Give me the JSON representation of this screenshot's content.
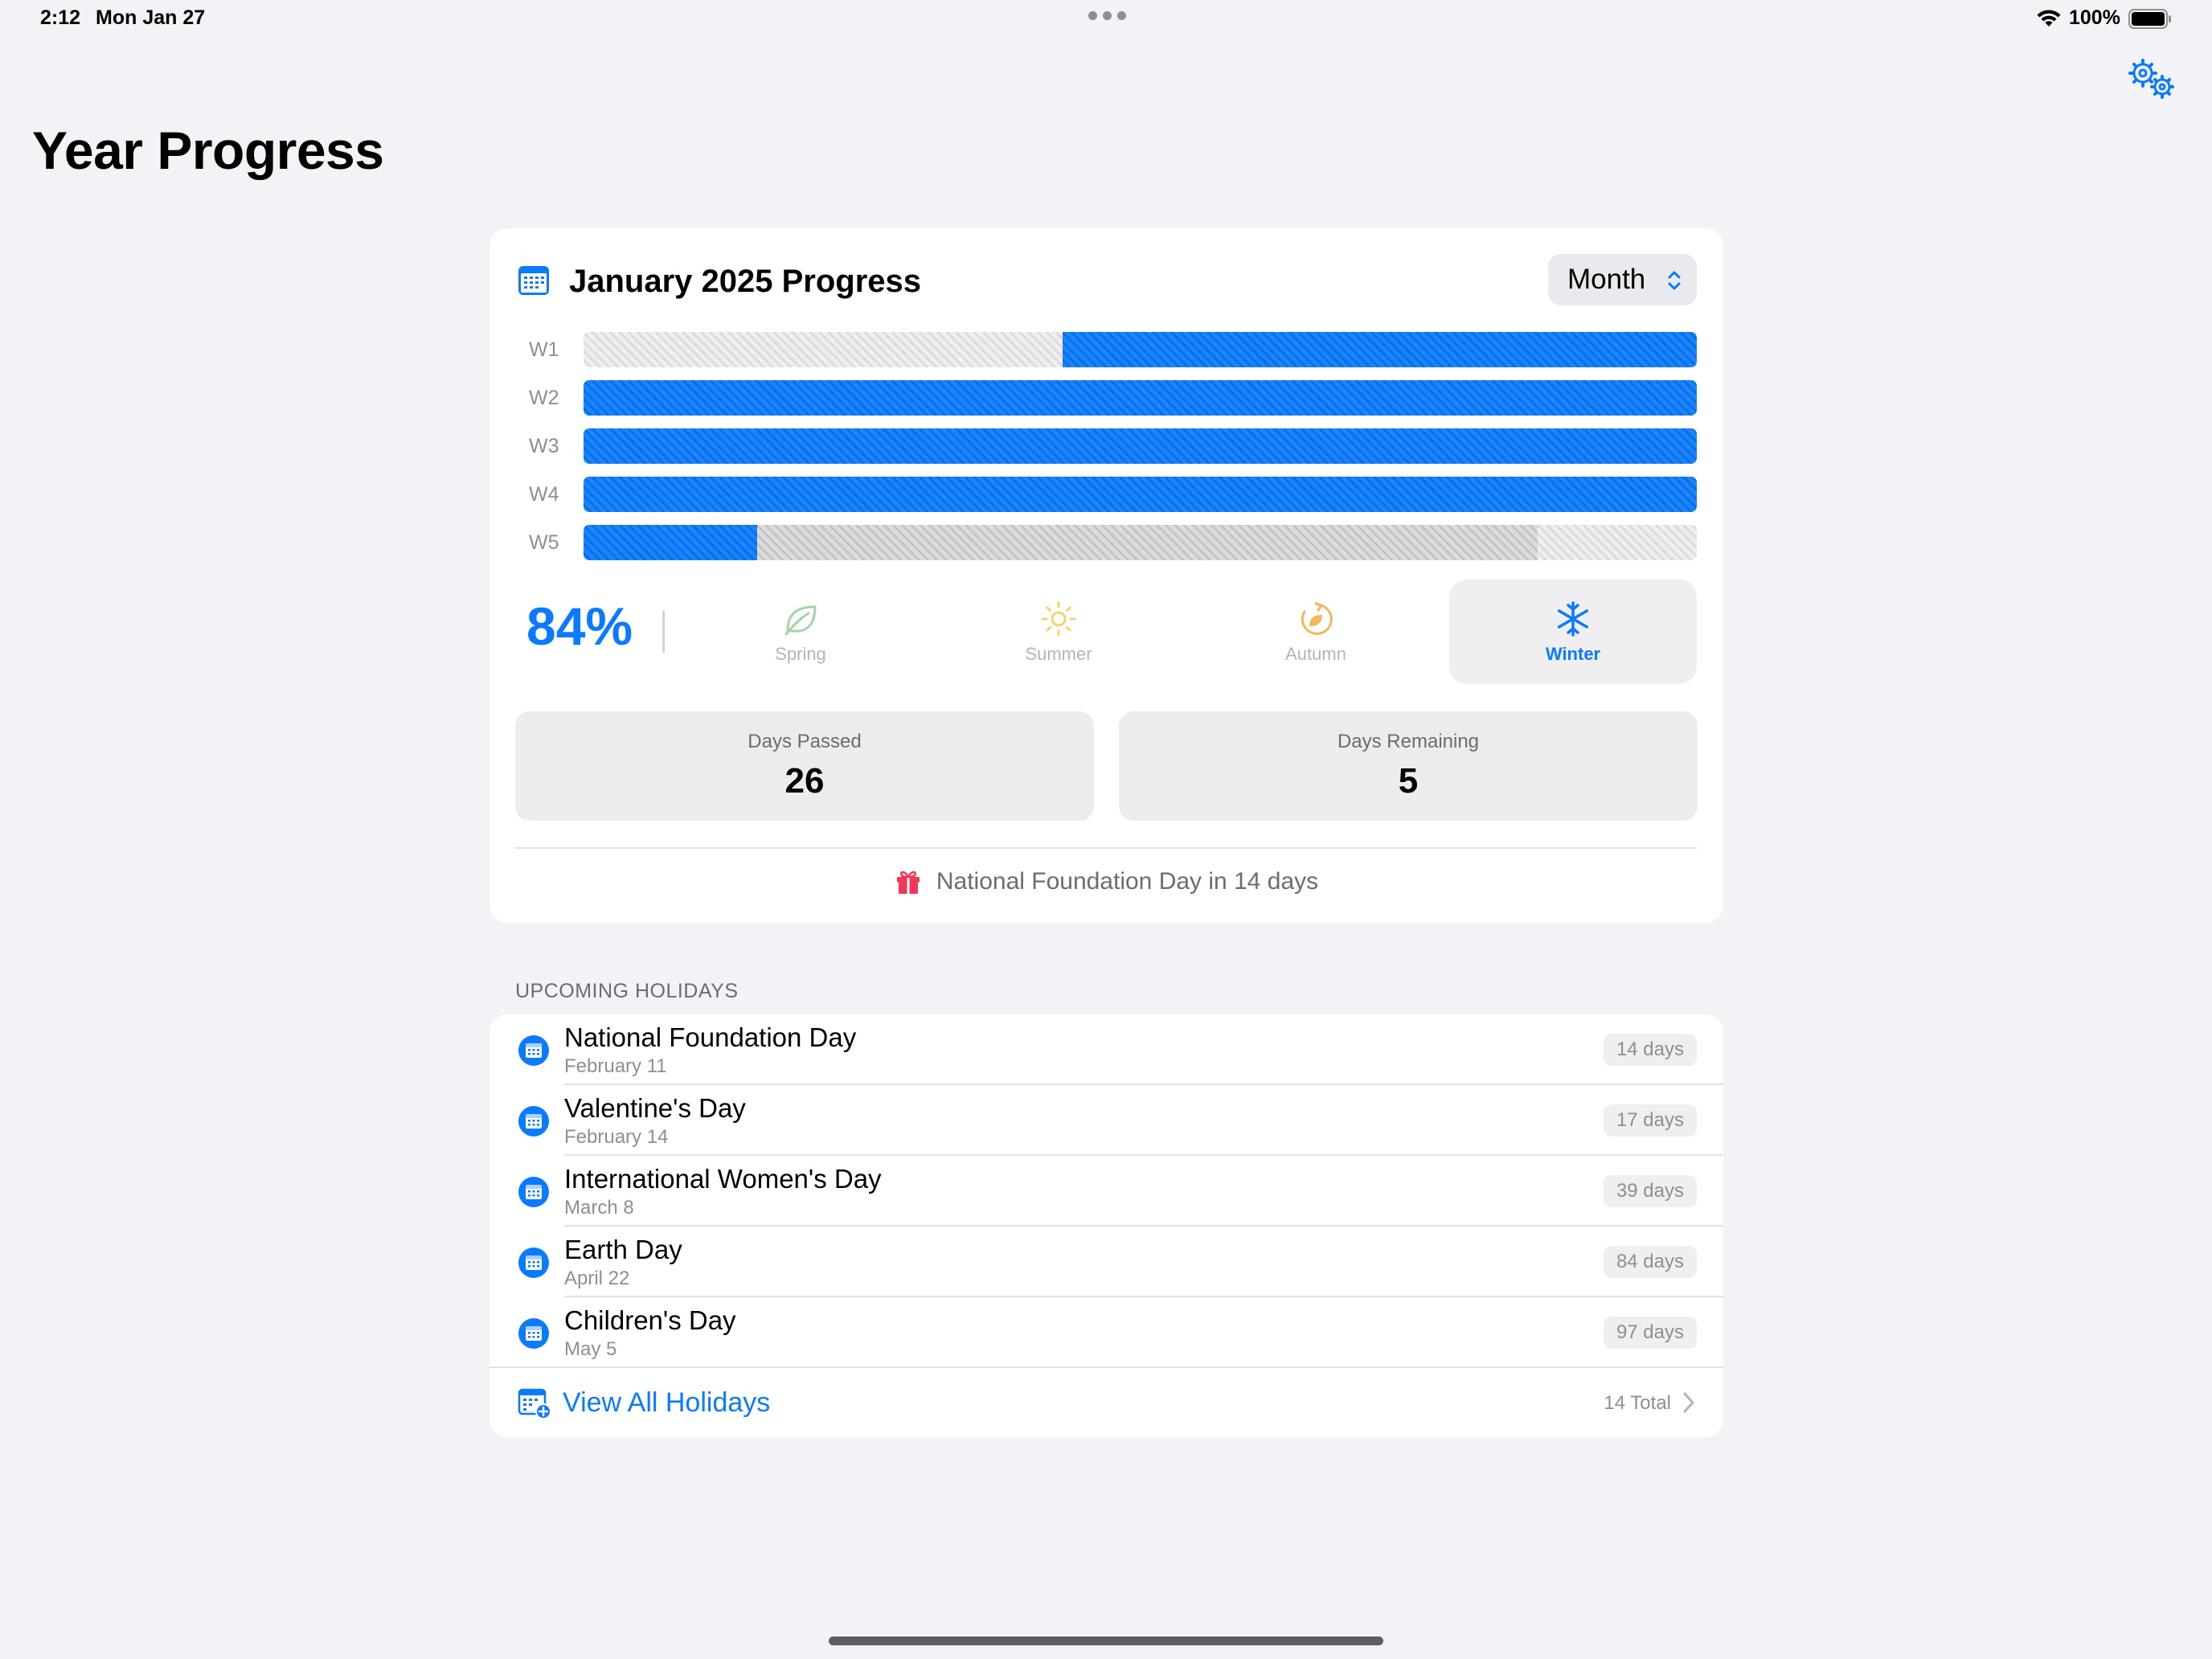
{
  "status_bar": {
    "time": "2:12",
    "date": "Mon Jan 27",
    "battery": "100%"
  },
  "page": {
    "title": "Year Progress"
  },
  "progress_card": {
    "title": "January 2025 Progress",
    "period_selector": "Month",
    "weeks": [
      {
        "label": "W1",
        "passed_start": 0.43,
        "passed_end": 1.0,
        "remaining_end": 1.0
      },
      {
        "label": "W2",
        "passed_start": 0.0,
        "passed_end": 1.0,
        "remaining_end": 1.0
      },
      {
        "label": "W3",
        "passed_start": 0.0,
        "passed_end": 1.0,
        "remaining_end": 1.0
      },
      {
        "label": "W4",
        "passed_start": 0.0,
        "passed_end": 1.0,
        "remaining_end": 1.0
      },
      {
        "label": "W5",
        "passed_start": 0.0,
        "passed_end": 0.156,
        "remaining_end": 0.857
      }
    ],
    "percent": "84%",
    "seasons": [
      {
        "label": "Spring",
        "icon": "leaf-icon",
        "color": "#9fd8a8",
        "active": false
      },
      {
        "label": "Summer",
        "icon": "sun-icon",
        "color": "#f6d36b",
        "active": false
      },
      {
        "label": "Autumn",
        "icon": "autumn-leaf-icon",
        "color": "#f4b75a",
        "active": false
      },
      {
        "label": "Winter",
        "icon": "snowflake-icon",
        "color": "#0a7aff",
        "active": true
      }
    ],
    "days_passed_label": "Days Passed",
    "days_passed": "26",
    "days_remaining_label": "Days Remaining",
    "days_remaining": "5",
    "next_holiday": "National Foundation Day in 14 days"
  },
  "holidays": {
    "section_title": "UPCOMING HOLIDAYS",
    "items": [
      {
        "name": "National Foundation Day",
        "date": "February 11",
        "days": "14 days"
      },
      {
        "name": "Valentine's Day",
        "date": "February 14",
        "days": "17 days"
      },
      {
        "name": "International Women's Day",
        "date": "March 8",
        "days": "39 days"
      },
      {
        "name": "Earth Day",
        "date": "April 22",
        "days": "84 days"
      },
      {
        "name": "Children's Day",
        "date": "May 5",
        "days": "97 days"
      }
    ],
    "view_all_label": "View All Holidays",
    "total": "14 Total"
  },
  "colors": {
    "accent": "#0a7aff",
    "gift": "#f2365a",
    "background": "#f2f2f7"
  }
}
